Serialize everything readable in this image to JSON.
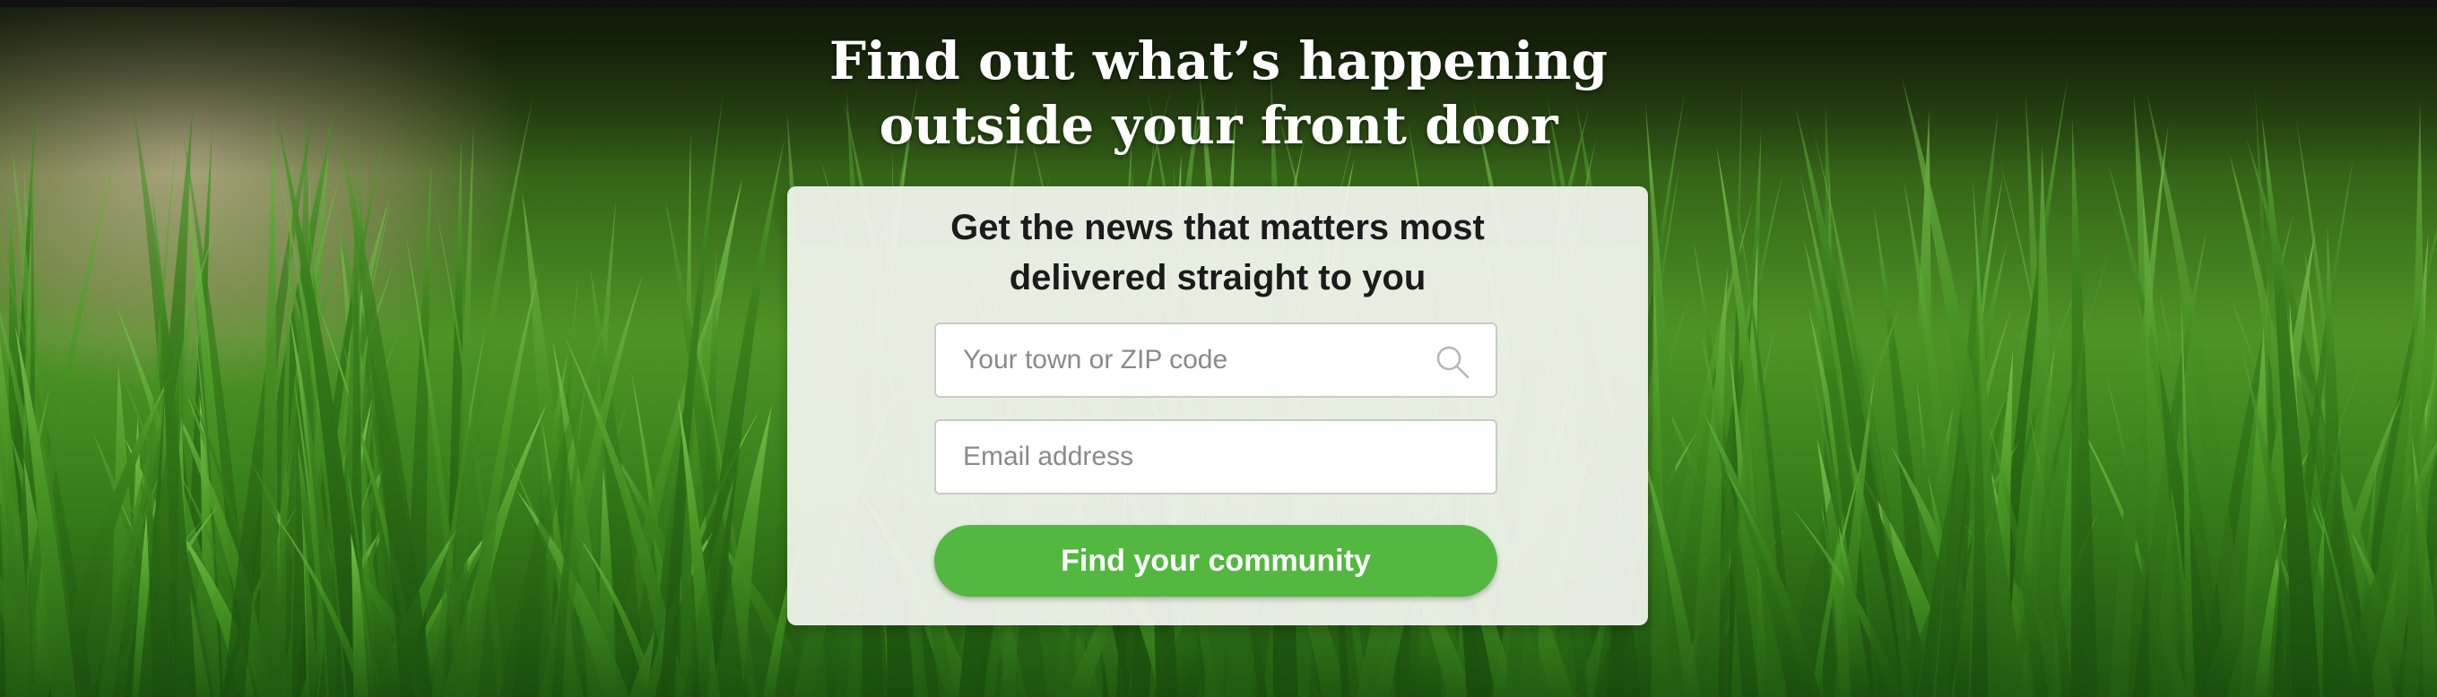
{
  "hero": {
    "headline_line1": "Find out what’s happening",
    "headline_line2": "outside your front door"
  },
  "signup_card": {
    "title_line1": "Get the news that matters most",
    "title_line2": "delivered straight to you",
    "town_field": {
      "placeholder": "Your town or ZIP code",
      "value": "",
      "icon": "search-icon"
    },
    "email_field": {
      "placeholder": "Email address",
      "value": ""
    },
    "submit_label": "Find your community"
  },
  "colors": {
    "accent_green": "#53b840",
    "card_background": "#f3f5f0",
    "headline_text": "#ffffff",
    "card_title_text": "#1b1b1b",
    "placeholder_text": "#8a8a8a"
  }
}
